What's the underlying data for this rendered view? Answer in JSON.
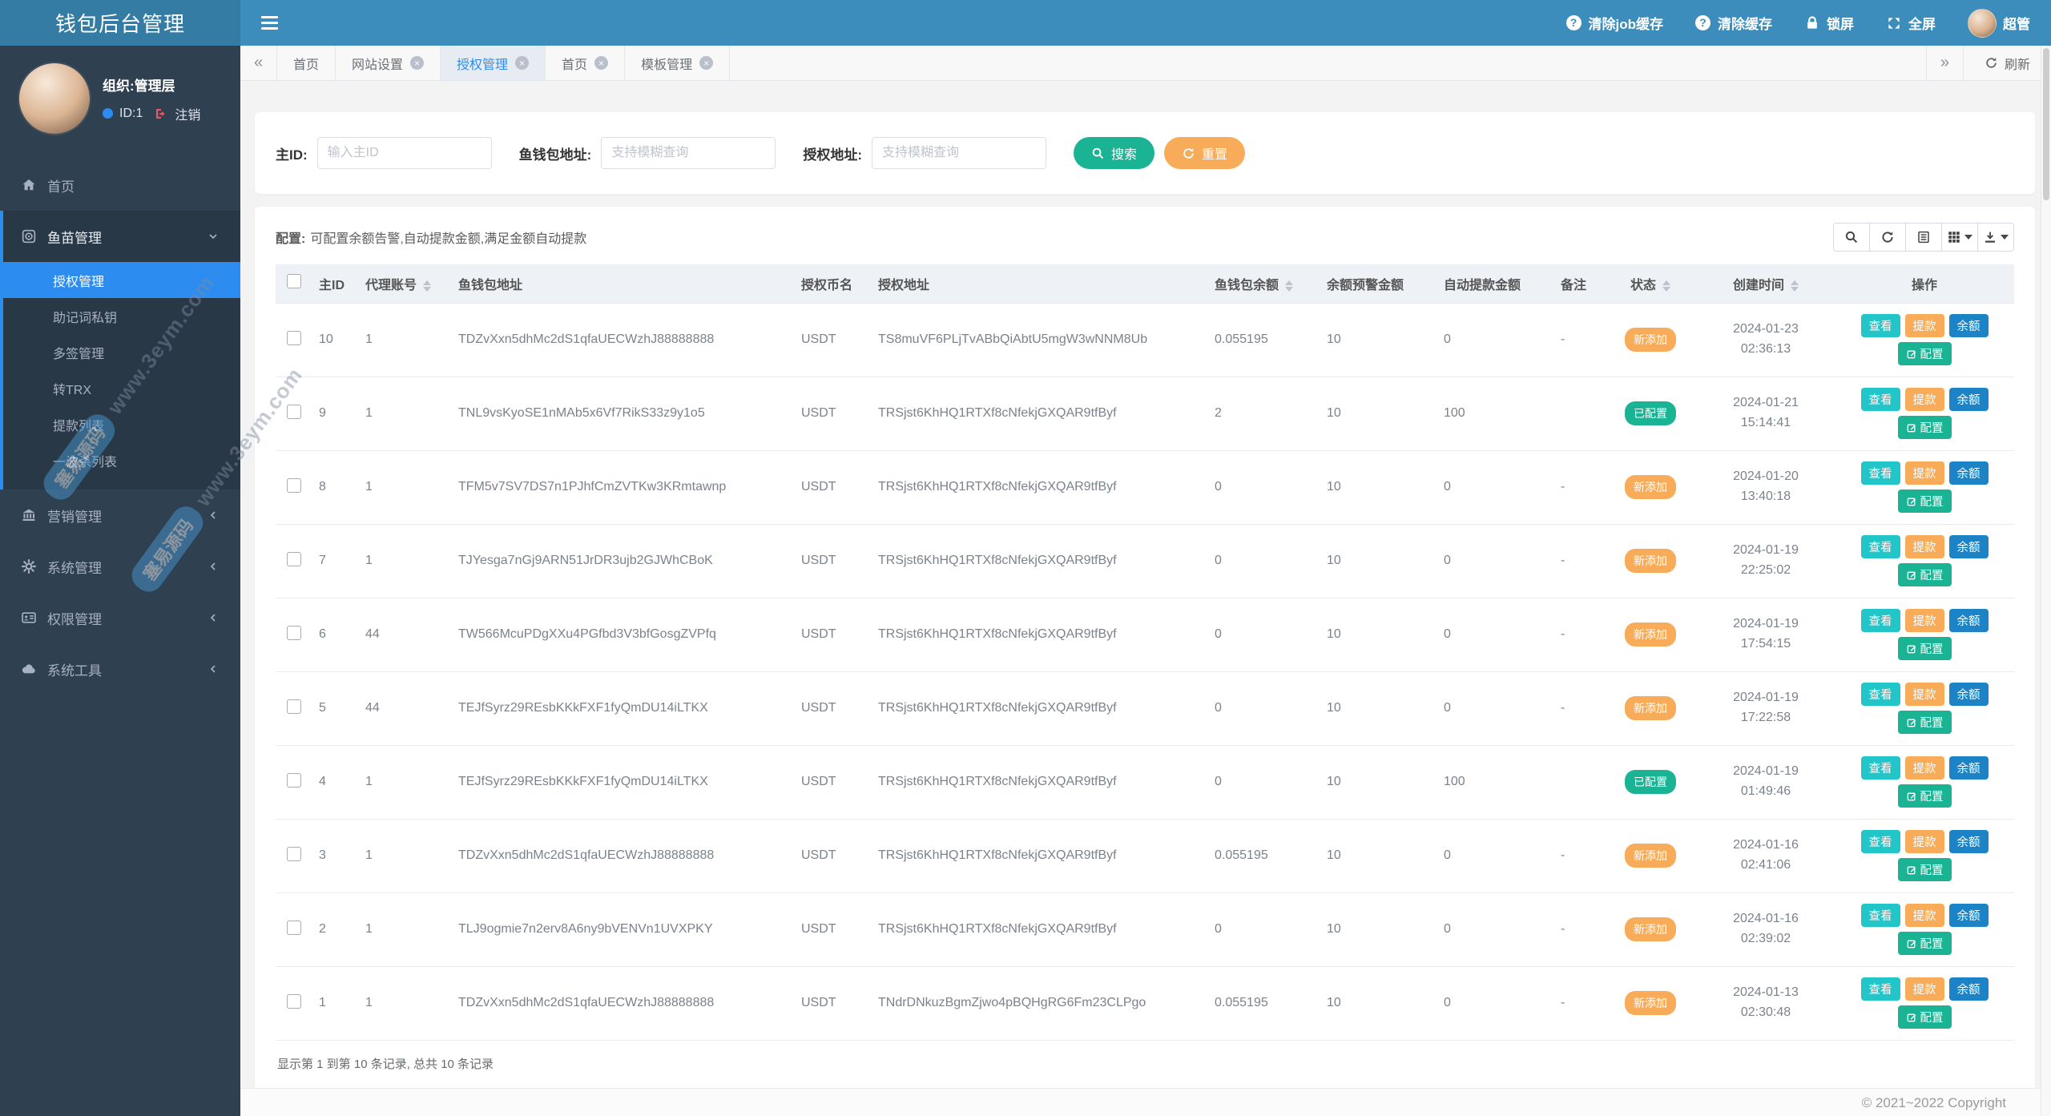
{
  "app": {
    "title": "钱包后台管理"
  },
  "theme": {
    "header": "#3c8dbc",
    "logo": "#357ca5",
    "sidebar": "#2f4050",
    "sidebarDark": "#293846",
    "accent": "#2d8cf0",
    "success": "#1ab394",
    "info": "#23c6c8",
    "warning": "#f8ac59",
    "primary": "#1c84c6",
    "danger": "#ed5565"
  },
  "header": {
    "nav": [
      {
        "name": "clear-job-cache",
        "icon": "question-circle-icon",
        "label": "清除job缓存"
      },
      {
        "name": "clear-cache",
        "icon": "question-circle-icon",
        "label": "清除缓存"
      },
      {
        "name": "lock-screen",
        "icon": "lock-icon",
        "label": "锁屏"
      },
      {
        "name": "fullscreen",
        "icon": "fullscreen-icon",
        "label": "全屏"
      },
      {
        "name": "user",
        "icon": "avatar",
        "label": "超管"
      }
    ]
  },
  "sidebar": {
    "user": {
      "org": "组织:管理层",
      "id": "ID:1",
      "logout": "注销"
    },
    "menu": [
      {
        "name": "home",
        "icon": "home-icon",
        "label": "首页"
      },
      {
        "name": "fish-management",
        "icon": "circle-dot-icon",
        "label": "鱼苗管理",
        "expanded": true,
        "children": [
          {
            "name": "auth-management",
            "label": "授权管理",
            "active": true
          },
          {
            "name": "mnemonic-private-key",
            "label": "助记词私钥"
          },
          {
            "name": "multisig-management",
            "label": "多签管理"
          },
          {
            "name": "transfer-trx",
            "label": "转TRX"
          },
          {
            "name": "withdraw-list",
            "label": "提款列表"
          },
          {
            "name": "onewave-kill-list",
            "label": "一波杀列表"
          }
        ]
      },
      {
        "name": "marketing-management",
        "icon": "bank-icon",
        "label": "营销管理",
        "chevron": "left"
      },
      {
        "name": "system-management",
        "icon": "gear-icon",
        "label": "系统管理",
        "chevron": "left"
      },
      {
        "name": "permission-management",
        "icon": "id-card-icon",
        "label": "权限管理",
        "chevron": "left"
      },
      {
        "name": "system-tools",
        "icon": "cloud-icon",
        "label": "系统工具",
        "chevron": "left"
      }
    ]
  },
  "tabs": {
    "items": [
      {
        "name": "home-1",
        "label": "首页",
        "closable": false,
        "active": false
      },
      {
        "name": "site-settings",
        "label": "网站设置",
        "closable": true,
        "active": false
      },
      {
        "name": "auth-management",
        "label": "授权管理",
        "closable": true,
        "active": true
      },
      {
        "name": "home-2",
        "label": "首页",
        "closable": true,
        "active": false
      },
      {
        "name": "template-management",
        "label": "模板管理",
        "closable": true,
        "active": false
      }
    ],
    "refresh_label": "刷新"
  },
  "search": {
    "fields": [
      {
        "name": "main-id",
        "label": "主ID:",
        "placeholder": "输入主ID",
        "value": ""
      },
      {
        "name": "fish-wallet-address",
        "label": "鱼钱包地址:",
        "placeholder": "支持模糊查询",
        "value": ""
      },
      {
        "name": "auth-address",
        "label": "授权地址:",
        "placeholder": "支持模糊查询",
        "value": ""
      }
    ],
    "search_label": "搜索",
    "reset_label": "重置"
  },
  "table": {
    "config_label": "配置:",
    "config_text": "可配置余额告警,自动提款金额,满足金额自动提款",
    "toolbar": [
      {
        "name": "search",
        "icon": "search-icon"
      },
      {
        "name": "refresh",
        "icon": "refresh-icon"
      },
      {
        "name": "toggle-view",
        "icon": "list-icon"
      },
      {
        "name": "columns",
        "icon": "grid-icon",
        "caret": true
      },
      {
        "name": "export",
        "icon": "download-icon",
        "caret": true
      }
    ],
    "columns": [
      {
        "key": "id",
        "label": "主ID",
        "sortable": false
      },
      {
        "key": "agent",
        "label": "代理账号",
        "sortable": true
      },
      {
        "key": "wallet",
        "label": "鱼钱包地址",
        "sortable": false
      },
      {
        "key": "coin",
        "label": "授权币名",
        "sortable": false
      },
      {
        "key": "auth",
        "label": "授权地址",
        "sortable": false
      },
      {
        "key": "balance",
        "label": "鱼钱包余额",
        "sortable": true
      },
      {
        "key": "warn",
        "label": "余额预警金额",
        "sortable": false
      },
      {
        "key": "auto",
        "label": "自动提款金额",
        "sortable": false
      },
      {
        "key": "remark",
        "label": "备注",
        "sortable": false
      },
      {
        "key": "status",
        "label": "状态",
        "sortable": true
      },
      {
        "key": "created",
        "label": "创建时间",
        "sortable": true
      },
      {
        "key": "actions",
        "label": "操作",
        "sortable": false
      }
    ],
    "actions": [
      {
        "name": "view",
        "label": "查看",
        "color": "info"
      },
      {
        "name": "withdraw",
        "label": "提款",
        "color": "warning"
      },
      {
        "name": "balance",
        "label": "余额",
        "color": "primary"
      },
      {
        "name": "configure",
        "label": "配置",
        "color": "success",
        "icon": "edit-icon"
      }
    ],
    "rows": [
      {
        "id": "10",
        "agent": "1",
        "wallet": "TDZvXxn5dhMc2dS1qfaUECWzhJ88888888",
        "coin": "USDT",
        "auth": "TS8muVF6PLjTvABbQiAbtU5mgW3wNNM8Ub",
        "balance": "0.055195",
        "warn": "10",
        "auto": "0",
        "remark": "-",
        "status": "新添加",
        "status_color": "warning",
        "date": "2024-01-23",
        "time": "02:36:13"
      },
      {
        "id": "9",
        "agent": "1",
        "wallet": "TNL9vsKyoSE1nMAb5x6Vf7RikS33z9y1o5",
        "coin": "USDT",
        "auth": "TRSjst6KhHQ1RTXf8cNfekjGXQAR9tfByf",
        "balance": "2",
        "warn": "10",
        "auto": "100",
        "remark": "",
        "status": "已配置",
        "status_color": "success",
        "date": "2024-01-21",
        "time": "15:14:41"
      },
      {
        "id": "8",
        "agent": "1",
        "wallet": "TFM5v7SV7DS7n1PJhfCmZVTKw3KRmtawnp",
        "coin": "USDT",
        "auth": "TRSjst6KhHQ1RTXf8cNfekjGXQAR9tfByf",
        "balance": "0",
        "warn": "10",
        "auto": "0",
        "remark": "-",
        "status": "新添加",
        "status_color": "warning",
        "date": "2024-01-20",
        "time": "13:40:18"
      },
      {
        "id": "7",
        "agent": "1",
        "wallet": "TJYesga7nGj9ARN51JrDR3ujb2GJWhCBoK",
        "coin": "USDT",
        "auth": "TRSjst6KhHQ1RTXf8cNfekjGXQAR9tfByf",
        "balance": "0",
        "warn": "10",
        "auto": "0",
        "remark": "-",
        "status": "新添加",
        "status_color": "warning",
        "date": "2024-01-19",
        "time": "22:25:02"
      },
      {
        "id": "6",
        "agent": "44",
        "wallet": "TW566McuPDgXXu4PGfbd3V3bfGosgZVPfq",
        "coin": "USDT",
        "auth": "TRSjst6KhHQ1RTXf8cNfekjGXQAR9tfByf",
        "balance": "0",
        "warn": "10",
        "auto": "0",
        "remark": "-",
        "status": "新添加",
        "status_color": "warning",
        "date": "2024-01-19",
        "time": "17:54:15"
      },
      {
        "id": "5",
        "agent": "44",
        "wallet": "TEJfSyrz29REsbKKkFXF1fyQmDU14iLTKX",
        "coin": "USDT",
        "auth": "TRSjst6KhHQ1RTXf8cNfekjGXQAR9tfByf",
        "balance": "0",
        "warn": "10",
        "auto": "0",
        "remark": "-",
        "status": "新添加",
        "status_color": "warning",
        "date": "2024-01-19",
        "time": "17:22:58"
      },
      {
        "id": "4",
        "agent": "1",
        "wallet": "TEJfSyrz29REsbKKkFXF1fyQmDU14iLTKX",
        "coin": "USDT",
        "auth": "TRSjst6KhHQ1RTXf8cNfekjGXQAR9tfByf",
        "balance": "0",
        "warn": "10",
        "auto": "100",
        "remark": "",
        "status": "已配置",
        "status_color": "success",
        "date": "2024-01-19",
        "time": "01:49:46"
      },
      {
        "id": "3",
        "agent": "1",
        "wallet": "TDZvXxn5dhMc2dS1qfaUECWzhJ88888888",
        "coin": "USDT",
        "auth": "TRSjst6KhHQ1RTXf8cNfekjGXQAR9tfByf",
        "balance": "0.055195",
        "warn": "10",
        "auto": "0",
        "remark": "-",
        "status": "新添加",
        "status_color": "warning",
        "date": "2024-01-16",
        "time": "02:41:06"
      },
      {
        "id": "2",
        "agent": "1",
        "wallet": "TLJ9ogmie7n2erv8A6ny9bVENVn1UVXPKY",
        "coin": "USDT",
        "auth": "TRSjst6KhHQ1RTXf8cNfekjGXQAR9tfByf",
        "balance": "0",
        "warn": "10",
        "auto": "0",
        "remark": "-",
        "status": "新添加",
        "status_color": "warning",
        "date": "2024-01-16",
        "time": "02:39:02"
      },
      {
        "id": "1",
        "agent": "1",
        "wallet": "TDZvXxn5dhMc2dS1qfaUECWzhJ88888888",
        "coin": "USDT",
        "auth": "TNdrDNkuzBgmZjwo4pBQHgRG6Fm23CLPgo",
        "balance": "0.055195",
        "warn": "10",
        "auto": "0",
        "remark": "-",
        "status": "新添加",
        "status_color": "warning",
        "date": "2024-01-13",
        "time": "02:30:48"
      }
    ],
    "summary": "显示第 1 到第 10 条记录, 总共 10 条记录"
  },
  "footer": {
    "copyright": "© 2021~2022 Copyright"
  },
  "watermark": {
    "badge": "塞易源码",
    "text": "www.3eym.com"
  }
}
